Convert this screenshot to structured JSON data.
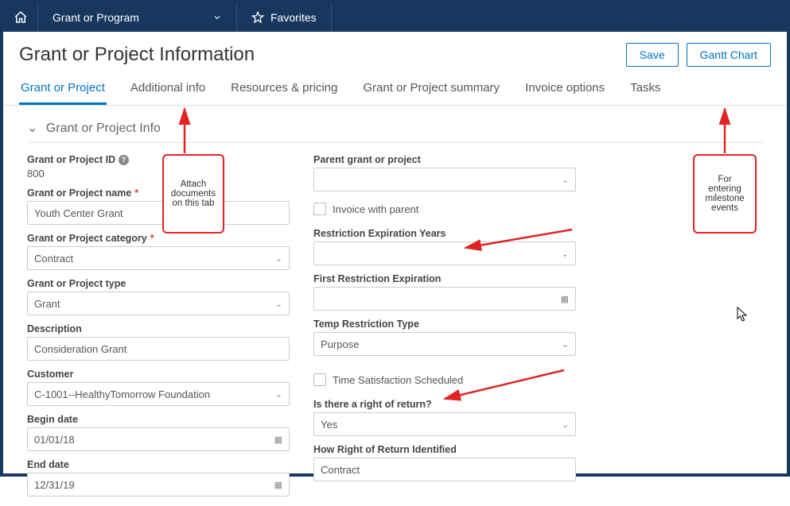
{
  "topbar": {
    "program_label": "Grant or Program",
    "favorites_label": "Favorites"
  },
  "header": {
    "title": "Grant or Project Information",
    "save_label": "Save",
    "gantt_label": "Gantt Chart"
  },
  "tabs": {
    "t0": "Grant or Project",
    "t1": "Additional info",
    "t2": "Resources & pricing",
    "t3": "Grant or Project summary",
    "t4": "Invoice options",
    "t5": "Tasks"
  },
  "section": {
    "title": "Grant or Project Info"
  },
  "left": {
    "id_label": "Grant or Project ID",
    "id_value": "800",
    "name_label": "Grant or Project name",
    "name_value": "Youth Center Grant",
    "category_label": "Grant or Project category",
    "category_value": "Contract",
    "type_label": "Grant or Project type",
    "type_value": "Grant",
    "desc_label": "Description",
    "desc_value": "Consideration Grant",
    "customer_label": "Customer",
    "customer_value": "C-1001--HealthyTomorrow Foundation",
    "begin_label": "Begin date",
    "begin_value": "01/01/18",
    "end_label": "End date",
    "end_value": "12/31/19"
  },
  "right": {
    "parent_label": "Parent grant or project",
    "parent_value": "",
    "invoice_parent_label": "Invoice with parent",
    "restr_years_label": "Restriction Expiration Years",
    "restr_years_value": "",
    "first_restr_label": "First Restriction Expiration",
    "first_restr_value": "",
    "temp_restr_label": "Temp Restriction Type",
    "temp_restr_value": "Purpose",
    "time_sat_label": "Time Satisfaction Scheduled",
    "ror_label": "Is there a right of return?",
    "ror_value": "Yes",
    "ror_how_label": "How Right of Return Identified",
    "ror_how_value": "Contract"
  },
  "callouts": {
    "attach": "Attach documents on this tab",
    "milestone": "For entering milestone events"
  }
}
